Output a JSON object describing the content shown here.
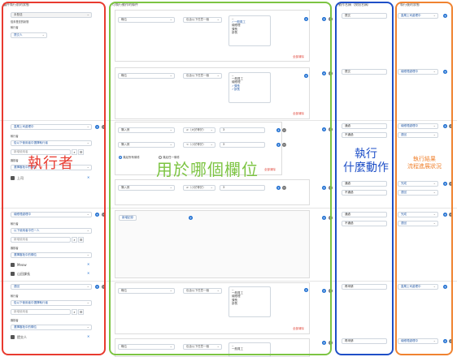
{
  "headers": {
    "col1": "審件執行前的狀態",
    "col2": "可執行動作的條件",
    "col3": "動作名稱（按鈕名稱）",
    "col4": "執行後的狀態"
  },
  "labels": {
    "unsent": "未發送",
    "unsent_sub": "從未發送的狀態",
    "executor": "執行者",
    "approver": "審核者",
    "remove_all": "全部清除",
    "and_all": "滿足所有條件",
    "or_one": "滿足任一條件",
    "add_record": "新增記錄",
    "search_ph": "新增使用者"
  },
  "row1": {
    "state": "未發送",
    "exec": "提交人",
    "field": "職位",
    "op": "包含以下任意一個",
    "options": [
      "--",
      "✓一般員工",
      "總經理",
      "課長",
      "部長"
    ],
    "action": "提交",
    "next": "直屬上司處理中"
  },
  "row2": {
    "field": "職位",
    "op": "包含以下任意一個",
    "options": [
      "--",
      "一般員工",
      "總經理",
      "✓課長",
      "✓部長"
    ],
    "action": "提交",
    "next": "總經理處理中"
  },
  "row3": {
    "state": "直屬上司處理中",
    "exec_sel": "從以下使用者中選擇執行者",
    "approver_sel": "選擇審批中的欄位",
    "user": "上司",
    "cond1": {
      "field": "購入數",
      "op": "≥（大於等於）",
      "val": "3"
    },
    "cond2": {
      "field": "購入數",
      "op": "<（小於等於）",
      "val": "3"
    },
    "cond3": {
      "field": "購入數",
      "op": "≥（小於等於）",
      "val": "3"
    },
    "actions": [
      [
        "通過",
        "總經理處理中"
      ],
      [
        "不通過",
        "退回"
      ],
      [
        "通過",
        "完成"
      ],
      [
        "不通過",
        "退回"
      ]
    ]
  },
  "row4": {
    "state": "總經理處理中",
    "exec_sel": "以下使用者中任一人",
    "approver_sel": "選擇審批中的欄位",
    "users": [
      "Meow",
      "山田課長"
    ],
    "actions": [
      [
        "通過",
        "完成"
      ],
      [
        "不通過",
        "退回"
      ]
    ]
  },
  "row5": {
    "state": "退回",
    "exec_sel": "從以下使用者中選擇執行者",
    "approver_sel": "選擇審批中的欄位",
    "user": "提交人",
    "field": "職位",
    "op": "包含以下任意一個",
    "options": [
      "--",
      "一般員工",
      "總經理",
      "課長",
      "部長"
    ],
    "actions": [
      [
        "再申請",
        "直屬上司處理中"
      ],
      [
        "再申請",
        "總經理處理中"
      ]
    ]
  },
  "annot": {
    "executor": "執行者",
    "field": "用於哪個欄位",
    "action": "執行\n什麼動作",
    "result": "執行結果\n流程進展狀況"
  }
}
